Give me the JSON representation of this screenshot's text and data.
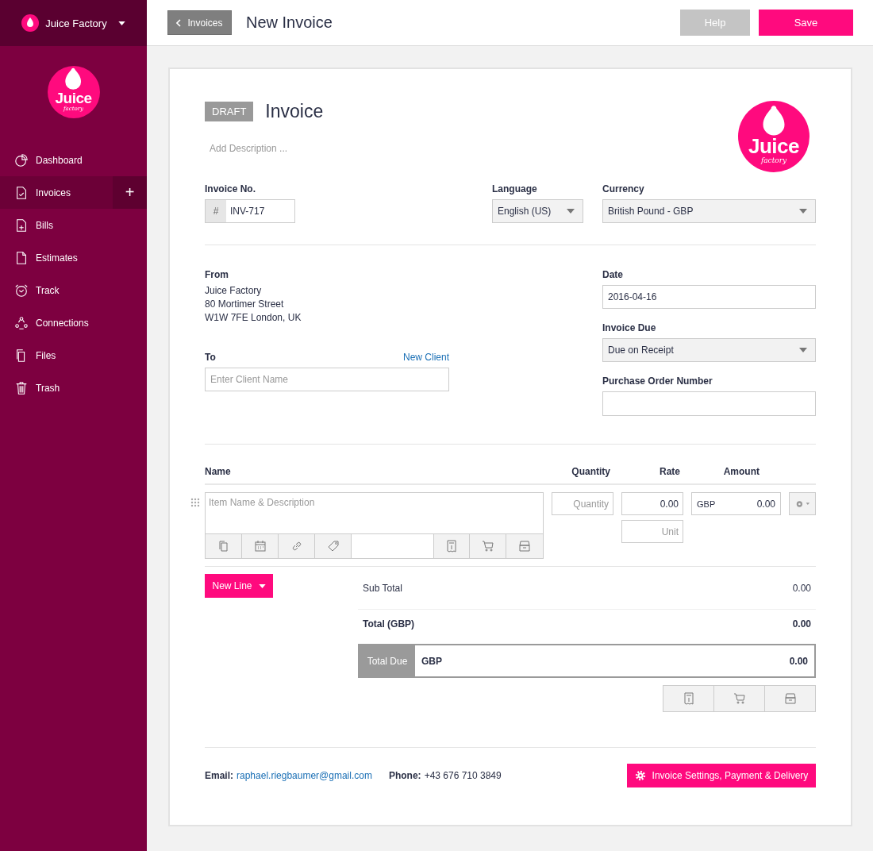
{
  "sidebar": {
    "company": "Juice Factory",
    "logo": {
      "word": "Juice",
      "sub": "factory"
    },
    "add_label": "+",
    "items": [
      {
        "label": "Dashboard",
        "selected": false
      },
      {
        "label": "Invoices",
        "selected": true
      },
      {
        "label": "Bills",
        "selected": false
      },
      {
        "label": "Estimates",
        "selected": false
      },
      {
        "label": "Track",
        "selected": false
      },
      {
        "label": "Connections",
        "selected": false
      },
      {
        "label": "Files",
        "selected": false
      },
      {
        "label": "Trash",
        "selected": false
      }
    ]
  },
  "topbar": {
    "back": "Invoices",
    "title": "New Invoice",
    "help": "Help",
    "save": "Save"
  },
  "invoice": {
    "status": "DRAFT",
    "heading": "Invoice",
    "description_placeholder": "Add Description ...",
    "logo": {
      "word": "Juice",
      "sub": "factory"
    },
    "invoice_no": {
      "label": "Invoice No.",
      "prefix": "#",
      "value": "INV-717"
    },
    "language": {
      "label": "Language",
      "value": "English (US)"
    },
    "currency": {
      "label": "Currency",
      "value": "British Pound - GBP"
    },
    "from": {
      "label": "From",
      "lines": [
        "Juice Factory",
        "80 Mortimer Street",
        "W1W 7FE London, UK"
      ]
    },
    "to": {
      "label": "To",
      "link": "New Client",
      "placeholder": "Enter Client Name"
    },
    "date": {
      "label": "Date",
      "value": "2016-04-16"
    },
    "due": {
      "label": "Invoice Due",
      "value": "Due on Receipt"
    },
    "po": {
      "label": "Purchase Order Number"
    },
    "columns": [
      "Name",
      "Quantity",
      "Rate",
      "Amount"
    ],
    "line": {
      "name_placeholder": "Item Name & Description",
      "quantity_placeholder": "Quantity",
      "rate": "0.00",
      "unit_placeholder": "Unit",
      "currency": "GBP",
      "amount": "0.00"
    },
    "new_line": "New Line",
    "subtotal": {
      "label": "Sub Total",
      "value": "0.00"
    },
    "total": {
      "label": "Total (GBP)",
      "value": "0.00"
    },
    "total_due": {
      "label": "Total Due",
      "currency": "GBP",
      "value": "0.00"
    },
    "footer": {
      "email_label": "Email:",
      "email": "raphael.riegbaumer@gmail.com",
      "phone_label": "Phone:",
      "phone": "+43 676 710 3849",
      "settings": "Invoice Settings, Payment & Delivery"
    }
  }
}
